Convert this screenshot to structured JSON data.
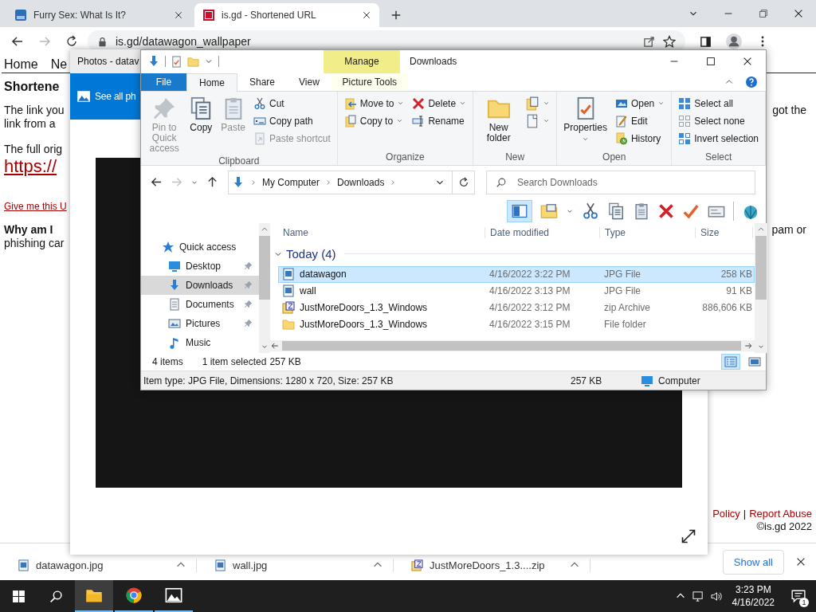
{
  "browser": {
    "tabs": [
      {
        "title": "Furry Sex: What Is It?",
        "selected": false
      },
      {
        "title": "is.gd - Shortened URL",
        "selected": true
      }
    ],
    "nav_buttons": [
      {
        "kind": "back",
        "disabled": false
      },
      {
        "kind": "forward",
        "disabled": true
      },
      {
        "kind": "reload",
        "disabled": false
      }
    ],
    "url": "is.gd/datawagon_wallpaper"
  },
  "page": {
    "nav": [
      "Home",
      "Ne"
    ],
    "heading": "Shortene",
    "intro_lines": [
      "The link you",
      "link from a"
    ],
    "intro_right": "got the",
    "full_url_label": "The full orig",
    "full_url": "https://",
    "give_link": "Give me this U",
    "why_heading": "Why am I",
    "why_right": "pam or",
    "why_line": "phishing car",
    "footer_links": [
      "Policy",
      "Report Abuse"
    ],
    "footer_separator": "|",
    "copyright": "©is.gd 2022"
  },
  "photos_window": {
    "title": "Photos - datav",
    "see_all": "See all ph"
  },
  "explorer": {
    "title": "Downloads",
    "context_tab": "Manage",
    "ribbon_tabs": [
      {
        "label": "File",
        "kind": "file",
        "selected": false
      },
      {
        "label": "Home",
        "kind": "tab",
        "selected": true
      },
      {
        "label": "Share",
        "kind": "tab",
        "selected": false
      },
      {
        "label": "View",
        "kind": "tab",
        "selected": false
      },
      {
        "label": "Picture Tools",
        "kind": "context",
        "selected": false
      }
    ],
    "ribbon_groups": [
      {
        "label": "Clipboard",
        "columns": [
          [
            {
              "label": "Pin to Quick access",
              "kind": "large",
              "disabled": true,
              "dropdown": false
            }
          ],
          [
            {
              "label": "Copy",
              "kind": "large",
              "disabled": false,
              "dropdown": false
            }
          ],
          [
            {
              "label": "Paste",
              "kind": "large",
              "disabled": true,
              "dropdown": false
            }
          ],
          [
            {
              "label": "Cut",
              "kind": "small",
              "disabled": false,
              "dropdown": false
            },
            {
              "label": "Copy path",
              "kind": "small",
              "disabled": false,
              "dropdown": false
            },
            {
              "label": "Paste shortcut",
              "kind": "small",
              "disabled": true,
              "dropdown": false
            }
          ]
        ]
      },
      {
        "label": "Organize",
        "columns": [
          [
            {
              "label": "Move to",
              "kind": "small",
              "disabled": false,
              "dropdown": true
            },
            {
              "label": "Copy to",
              "kind": "small",
              "disabled": false,
              "dropdown": true
            }
          ],
          [
            {
              "label": "Delete",
              "kind": "small",
              "disabled": false,
              "dropdown": true
            },
            {
              "label": "Rename",
              "kind": "small",
              "disabled": false,
              "dropdown": false
            }
          ]
        ]
      },
      {
        "label": "New",
        "columns": [
          [
            {
              "label": "New folder",
              "kind": "large",
              "disabled": false,
              "dropdown": false
            }
          ],
          [
            {
              "kind": "icon",
              "disabled": false,
              "dropdown": true
            },
            {
              "kind": "icon",
              "disabled": false,
              "dropdown": true
            }
          ]
        ]
      },
      {
        "label": "Open",
        "columns": [
          [
            {
              "label": "Properties",
              "kind": "large",
              "disabled": false,
              "dropdown": true
            }
          ],
          [
            {
              "label": "Open",
              "kind": "small",
              "disabled": false,
              "dropdown": true
            },
            {
              "label": "Edit",
              "kind": "small",
              "disabled": false,
              "dropdown": false
            },
            {
              "label": "History",
              "kind": "small",
              "disabled": false,
              "dropdown": false
            }
          ]
        ]
      },
      {
        "label": "Select",
        "columns": [
          [
            {
              "label": "Select all",
              "kind": "small",
              "disabled": false,
              "dropdown": false
            },
            {
              "label": "Select none",
              "kind": "small",
              "disabled": false,
              "dropdown": false
            },
            {
              "label": "Invert selection",
              "kind": "small",
              "disabled": false,
              "dropdown": false
            }
          ]
        ]
      }
    ],
    "address": {
      "path": [
        "My Computer",
        "Downloads"
      ],
      "back_disabled": false,
      "forward_disabled": true
    },
    "search_placeholder": "Search Downloads",
    "nav_pane": [
      {
        "label": "Quick access",
        "kind": "heading",
        "selected": false,
        "pinned": false
      },
      {
        "label": "Desktop",
        "kind": "desktop",
        "selected": false,
        "pinned": true
      },
      {
        "label": "Downloads",
        "kind": "downloads",
        "selected": true,
        "pinned": true
      },
      {
        "label": "Documents",
        "kind": "documents",
        "selected": false,
        "pinned": true
      },
      {
        "label": "Pictures",
        "kind": "pictures",
        "selected": false,
        "pinned": true
      },
      {
        "label": "Music",
        "kind": "music",
        "selected": false,
        "pinned": false
      }
    ],
    "columns": [
      "Name",
      "Date modified",
      "Type",
      "Size"
    ],
    "group": {
      "label": "Today (4)",
      "expanded": true
    },
    "files": [
      {
        "name": "datawagon",
        "kind": "image",
        "date": "4/16/2022 3:22 PM",
        "type": "JPG File",
        "size": "258 KB",
        "selected": true
      },
      {
        "name": "wall",
        "kind": "image",
        "date": "4/16/2022 3:13 PM",
        "type": "JPG File",
        "size": "91 KB",
        "selected": false
      },
      {
        "name": "JustMoreDoors_1.3_Windows",
        "kind": "archive",
        "date": "4/16/2022 3:12 PM",
        "type": "zip Archive",
        "size": "886,606 KB",
        "selected": false
      },
      {
        "name": "JustMoreDoors_1.3_Windows",
        "kind": "folder",
        "date": "4/16/2022 3:15 PM",
        "type": "File folder",
        "selected": false
      }
    ],
    "status": {
      "count": "4 items",
      "selection": "1 item selected",
      "selection_size": "257 KB"
    },
    "details": {
      "info": "Item type: JPG File, Dimensions: 1280 x 720, Size: 257 KB",
      "size": "257 KB",
      "location": "Computer"
    }
  },
  "downloads_bar": {
    "items": [
      {
        "name": "datawagon.jpg",
        "kind": "image"
      },
      {
        "name": "wall.jpg",
        "kind": "image"
      },
      {
        "name": "JustMoreDoors_1.3....zip",
        "kind": "archive"
      }
    ],
    "show_all": "Show all"
  },
  "taskbar": {
    "apps": [
      {
        "kind": "file_manager",
        "selected": true
      },
      {
        "kind": "browser",
        "selected": false
      },
      {
        "kind": "photos",
        "selected": false
      }
    ],
    "time": "3:23 PM",
    "date": "4/16/2022",
    "notifications": "1"
  }
}
